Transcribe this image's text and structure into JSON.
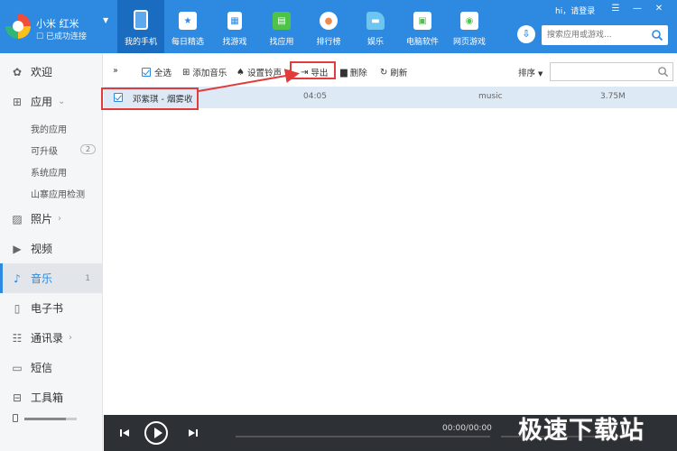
{
  "device": {
    "name": "小米 红米",
    "status": "已成功连接"
  },
  "nav": [
    {
      "label": "我的手机",
      "icon": "phone-icon",
      "color": "#ffffff"
    },
    {
      "label": "每日精选",
      "icon": "star-calendar-icon",
      "color": "#ffffff"
    },
    {
      "label": "找游戏",
      "icon": "gamepad-icon",
      "color": "#ffffff"
    },
    {
      "label": "找应用",
      "icon": "bag-icon",
      "color": "#4fc24a"
    },
    {
      "label": "排行榜",
      "icon": "medal-icon",
      "color": "#f08a4b"
    },
    {
      "label": "娱乐",
      "icon": "entertainment-icon",
      "color": "#6ec6f0"
    },
    {
      "label": "电脑软件",
      "icon": "monitor-icon",
      "color": "#4fc24a"
    },
    {
      "label": "网页游戏",
      "icon": "web-game-icon",
      "color": "#4fc24a"
    }
  ],
  "login_text": "hi，请登录",
  "search_placeholder": "搜索应用或游戏...",
  "sidebar": {
    "welcome": "欢迎",
    "apps": "应用",
    "my_apps": "我的应用",
    "upgradable": "可升级",
    "upgradable_count": "2",
    "system_apps": "系统应用",
    "knockoff_check": "山寨应用检测",
    "photos": "照片",
    "videos": "视频",
    "music": "音乐",
    "music_count": "1",
    "ebooks": "电子书",
    "contacts": "通讯录",
    "sms": "短信",
    "toolbox": "工具箱",
    "storage_fraction": 0.8
  },
  "toolbar": {
    "expand": "»",
    "select_all": "全选",
    "add_music": "添加音乐",
    "set_ringtone": "设置铃声",
    "export": "导出",
    "delete": "删除",
    "refresh": "刷新",
    "sort": "排序"
  },
  "track": {
    "title": "邓紫琪 - 烟雾收",
    "duration": "04:05",
    "type": "music",
    "size": "3.75M"
  },
  "player": {
    "time": "00:00/00:00"
  },
  "watermark": "极速下载站",
  "accent_color": "#2d8ae0",
  "highlight_color": "#e23b3b"
}
